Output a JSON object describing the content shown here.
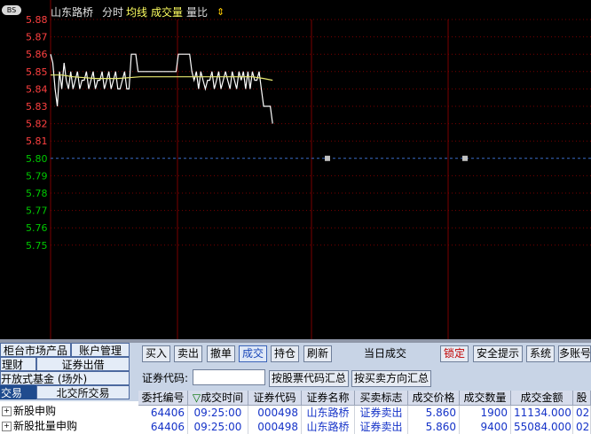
{
  "chart_header": {
    "badge": "BS",
    "stock_name": "山东路桥",
    "mode_fenshi": "分时",
    "mode_junxian": "均线",
    "mode_volume": "成交量",
    "mode_liangbi": "量比",
    "arrow": "⇕"
  },
  "colors": {
    "price_up": "#ff4040",
    "price_base": "#00c800",
    "price_down": "#00c800",
    "grid": "#7a0000",
    "price_line": "#ffffff",
    "avg_line": "#e8e870",
    "base_line": "#3a6cc8"
  },
  "chart_data": {
    "type": "line",
    "title": "",
    "xlabel": "",
    "ylabel": "",
    "ylim": [
      5.74,
      5.88
    ],
    "y_ticks": [
      "5.88",
      "5.87",
      "5.86",
      "5.85",
      "5.84",
      "5.83",
      "5.82",
      "5.81",
      "5.80",
      "5.79",
      "5.78",
      "5.77",
      "5.76",
      "5.75"
    ],
    "base_price": 5.8,
    "total_points": 242,
    "series": [
      {
        "role": "price",
        "x": [
          0,
          1,
          2,
          3,
          4,
          5,
          6,
          7,
          8,
          9,
          10,
          11,
          12,
          13,
          14,
          15,
          16,
          17,
          18,
          19,
          20,
          21,
          22,
          23,
          24,
          25,
          26,
          27,
          28,
          29,
          30,
          31,
          32,
          33,
          34,
          35,
          36,
          37,
          38,
          39,
          40,
          41,
          42,
          43,
          44,
          45,
          46,
          47,
          48,
          49,
          50,
          51,
          52,
          53,
          54,
          55,
          56,
          57,
          58,
          59,
          60,
          61,
          62,
          63,
          64,
          65,
          66,
          67,
          68,
          69,
          70,
          71,
          72,
          73,
          74,
          75,
          76,
          77,
          78,
          79,
          80,
          81,
          82,
          83,
          84,
          85,
          86,
          87,
          88,
          89,
          90,
          91,
          92,
          93,
          94,
          95,
          96,
          97,
          98,
          99
        ],
        "values": [
          5.86,
          5.855,
          5.84,
          5.83,
          5.85,
          5.84,
          5.855,
          5.845,
          5.84,
          5.85,
          5.84,
          5.845,
          5.85,
          5.84,
          5.845,
          5.845,
          5.85,
          5.84,
          5.845,
          5.85,
          5.84,
          5.845,
          5.845,
          5.85,
          5.84,
          5.845,
          5.85,
          5.84,
          5.845,
          5.85,
          5.84,
          5.84,
          5.845,
          5.85,
          5.84,
          5.84,
          5.86,
          5.86,
          5.86,
          5.85,
          5.85,
          5.85,
          5.85,
          5.85,
          5.85,
          5.85,
          5.85,
          5.85,
          5.85,
          5.85,
          5.85,
          5.85,
          5.85,
          5.85,
          5.85,
          5.85,
          5.85,
          5.86,
          5.86,
          5.86,
          5.86,
          5.86,
          5.86,
          5.85,
          5.845,
          5.85,
          5.84,
          5.85,
          5.845,
          5.84,
          5.845,
          5.845,
          5.85,
          5.84,
          5.845,
          5.85,
          5.84,
          5.845,
          5.85,
          5.845,
          5.84,
          5.85,
          5.845,
          5.84,
          5.85,
          5.845,
          5.85,
          5.84,
          5.85,
          5.84,
          5.85,
          5.845,
          5.845,
          5.85,
          5.84,
          5.83,
          5.83,
          5.83,
          5.83,
          5.82
        ]
      },
      {
        "role": "average",
        "x": [
          0,
          5,
          10,
          20,
          30,
          40,
          50,
          60,
          70,
          80,
          90,
          95,
          99
        ],
        "values": [
          5.848,
          5.848,
          5.847,
          5.846,
          5.846,
          5.847,
          5.847,
          5.847,
          5.847,
          5.847,
          5.847,
          5.846,
          5.845
        ]
      }
    ]
  },
  "left_panel": {
    "btn_market": "柜台市场产品",
    "btn_account": "账户管理",
    "btn_cai": "理财",
    "btn_zhengquan": "证券出借",
    "btn_fund": "开放式基金 (场外)",
    "btn_trade": "交易",
    "btn_beijiao": "北交所交易",
    "tree_ipo": "新股申购",
    "tree_batch": "新股批量申购"
  },
  "toolbar": {
    "buy": "买入",
    "sell": "卖出",
    "cancel": "撤单",
    "deal": "成交",
    "position": "持仓",
    "refresh": "刷新",
    "today_deal": "当日成交",
    "lock": "锁定",
    "safety": "安全提示",
    "system": "系统",
    "multi_account": "多账号"
  },
  "filter": {
    "code_label": "证券代码:",
    "code_value": "",
    "by_code": "按股票代码汇总",
    "by_direction": "按买卖方向汇总"
  },
  "table": {
    "headers": [
      "委托编号",
      "成交时间",
      "证券代码",
      "证券名称",
      "买卖标志",
      "成交价格",
      "成交数量",
      "成交金额",
      "股"
    ],
    "sort_marker": "▽",
    "rows": [
      [
        "64406",
        "09:25:00",
        "000498",
        "山东路桥",
        "证券卖出",
        "5.860",
        "1900",
        "11134.000",
        "02"
      ],
      [
        "64406",
        "09:25:00",
        "000498",
        "山东路桥",
        "证券卖出",
        "5.860",
        "9400",
        "55084.000",
        "02"
      ]
    ]
  }
}
